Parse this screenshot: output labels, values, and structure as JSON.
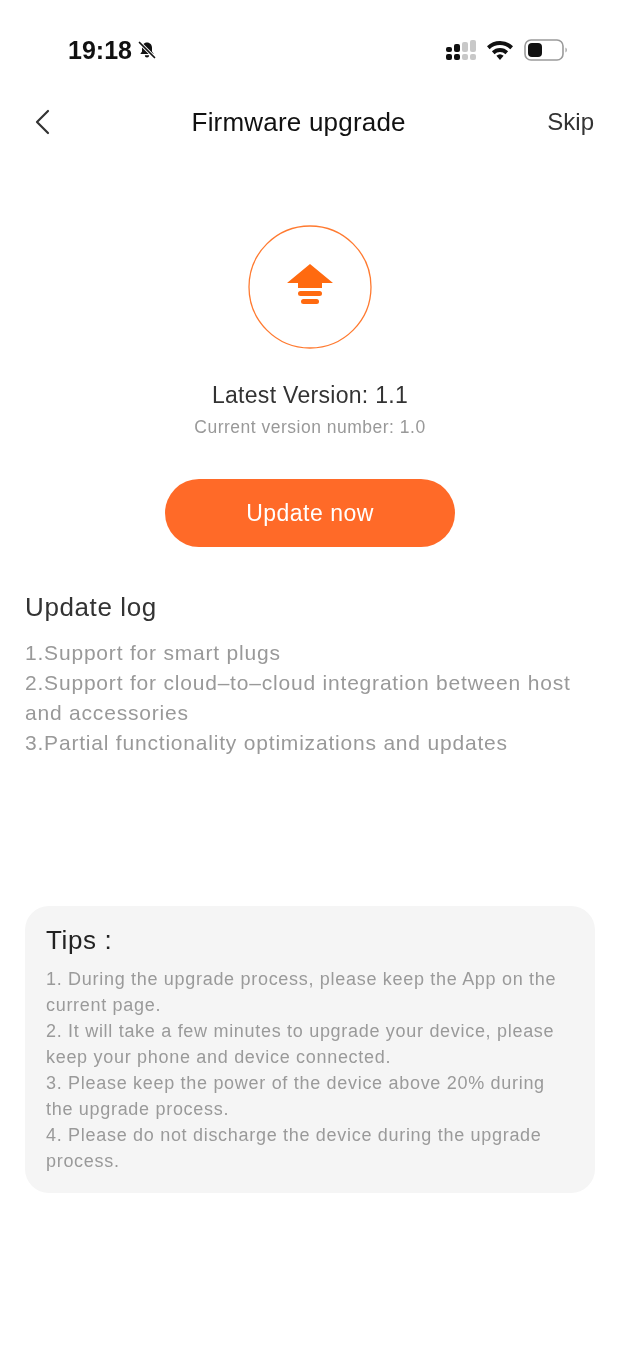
{
  "status_bar": {
    "time": "19:18"
  },
  "header": {
    "title": "Firmware upgrade",
    "action": "Skip"
  },
  "version": {
    "latest": "Latest Version: 1.1",
    "current": "Current version number: 1.0"
  },
  "update_button": {
    "label": "Update now"
  },
  "update_log": {
    "title": "Update log",
    "items": [
      "1.Support for smart plugs",
      "2.Support for cloud–to–cloud integration between host and accessories",
      "3.Partial functionality optimizations and updates"
    ]
  },
  "tips": {
    "title": "Tips :",
    "items": [
      "1. During the upgrade process, please keep the App on the current page.",
      "2. It will take a few minutes to upgrade your device, please keep your phone and device connected.",
      "3. Please keep the power of the device above 20% during the upgrade process.",
      "4. Please do not discharge the device during the upgrade process."
    ]
  }
}
